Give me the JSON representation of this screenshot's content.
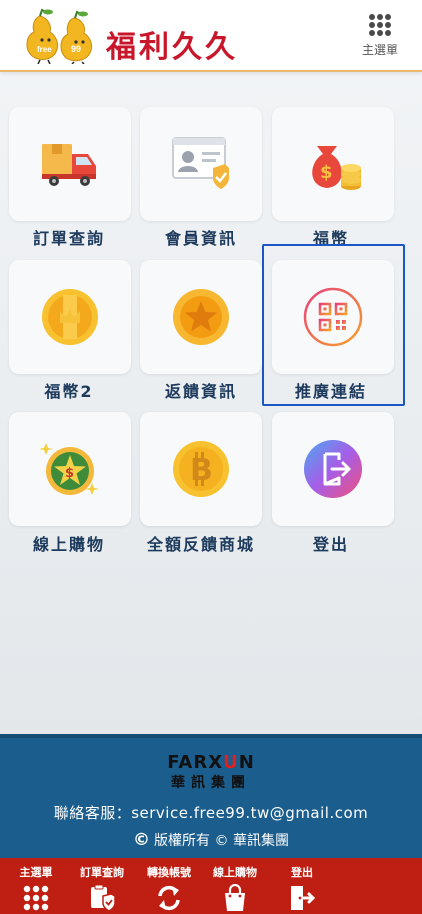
{
  "header": {
    "logo_text": "福利久久",
    "mascot_left_text": "free",
    "mascot_right_text": "99",
    "menu_label": "主選單"
  },
  "tiles": [
    {
      "label": "訂單查詢",
      "icon": "delivery-truck-icon"
    },
    {
      "label": "會員資訊",
      "icon": "member-card-icon"
    },
    {
      "label": "福幣",
      "icon": "money-bag-icon"
    },
    {
      "label": "福幣2",
      "icon": "gold-crown-coin-icon"
    },
    {
      "label": "返饋資訊",
      "icon": "star-coin-icon"
    },
    {
      "label": "推廣連結",
      "icon": "qr-code-icon"
    },
    {
      "label": "線上購物",
      "icon": "dollar-coin-icon"
    },
    {
      "label": "全額反饋商城",
      "icon": "bitcoin-icon"
    },
    {
      "label": "登出",
      "icon": "logout-icon"
    }
  ],
  "footer": {
    "brand_en_main": "FARX",
    "brand_en_accent": "U",
    "brand_en_end": "N",
    "brand_zh": "華訊集團",
    "contact": "聯絡客服：service.free99.tw@gmail.com",
    "copyright_symbol": "©",
    "copyright": "版權所有 © 華訊集團"
  },
  "bottom_nav": [
    {
      "label": "主選單",
      "icon": "grid-icon"
    },
    {
      "label": "訂單查詢",
      "icon": "clipboard-shield-icon"
    },
    {
      "label": "轉換帳號",
      "icon": "refresh-icon"
    },
    {
      "label": "線上購物",
      "icon": "shopping-bag-icon"
    },
    {
      "label": "登出",
      "icon": "logout-icon"
    }
  ],
  "colors": {
    "brand_red": "#c8162a",
    "label_navy": "#1d3a5c",
    "footer_blue": "#1b5d8c",
    "bottom_bar_red": "#bf1f12",
    "highlight_blue": "#1a56c4"
  }
}
